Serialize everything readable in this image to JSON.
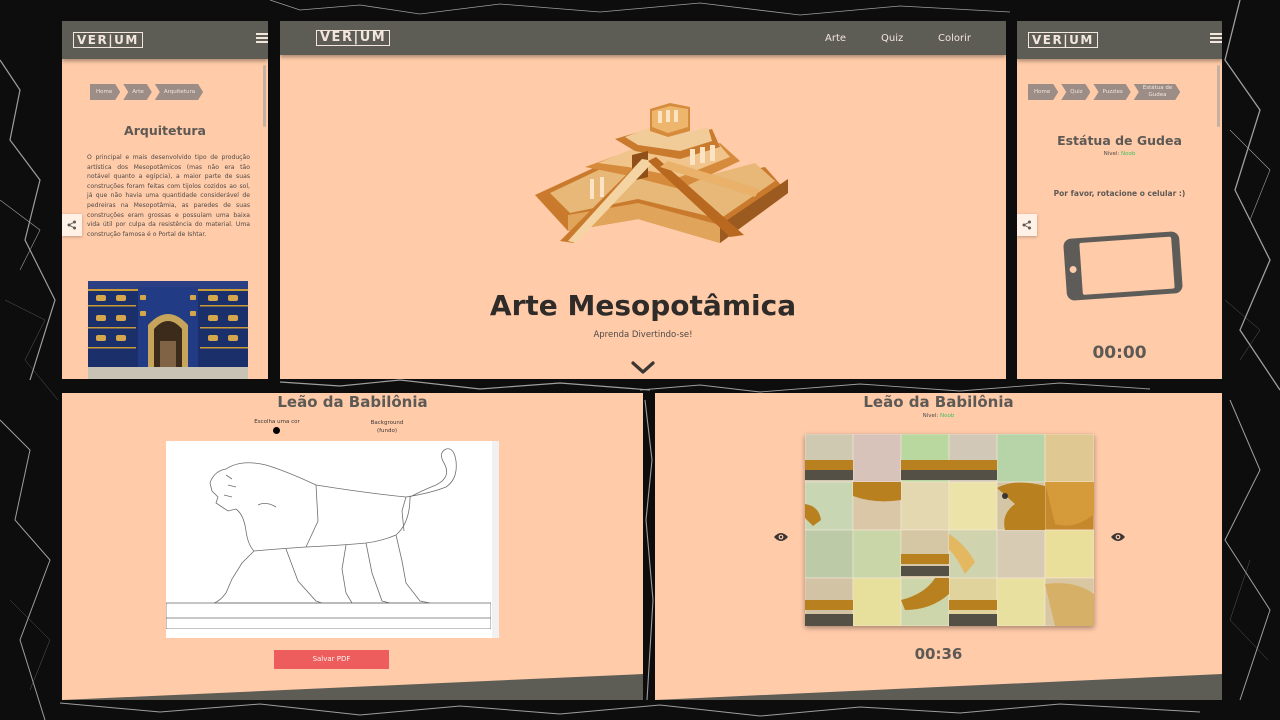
{
  "brand": {
    "logo": "VER|UM"
  },
  "main": {
    "nav": [
      "Arte",
      "Quiz",
      "Colorir"
    ],
    "hero_title": "Arte Mesopotâmica",
    "hero_subtitle": "Aprenda Divertindo-se!"
  },
  "architecture": {
    "breadcrumbs": [
      "Home",
      "Arte",
      "Arquitetura"
    ],
    "heading": "Arquitetura",
    "body": "O principal e mais desenvolvido tipo de produção artística dos Mesopotâmicos (mas não era tão notável quanto a egípcia), a maior parte de suas construções foram feitas com tijolos cozidos ao sol, já que não havia uma quantidade considerável de pedreiras na Mesopotâmia, as paredes de suas construções eram grossas e possuíam uma baixa vida útil por culpa da resistência do material. Uma construção famosa é o Portal de Ishtar."
  },
  "gudea": {
    "breadcrumbs": [
      "Home",
      "Quiz",
      "Puzzles",
      "Estátua de\nGudea"
    ],
    "heading": "Estátua de Gudea",
    "level_label": "Nível:",
    "level_value": "Noob",
    "rotate_message": "Por favor, rotacione o celular :)",
    "timer": "00:00"
  },
  "coloring": {
    "heading": "Leão da Babilônia",
    "color_label": "Escolha uma cor",
    "background_label": "Background (fundo)",
    "save_button": "Salvar PDF"
  },
  "puzzle": {
    "heading": "Leão da Babilônia",
    "level_label": "Nível:",
    "level_value": "Noob",
    "timer": "00:36"
  },
  "colors": {
    "peach": "#ffcba9",
    "header": "#5d5c55",
    "save_button": "#ee5d5d",
    "noob": "#3fbf5e"
  },
  "icons": [
    "menu-icon",
    "share-icon",
    "chevron-down-icon",
    "eye-icon",
    "phone-icon"
  ]
}
